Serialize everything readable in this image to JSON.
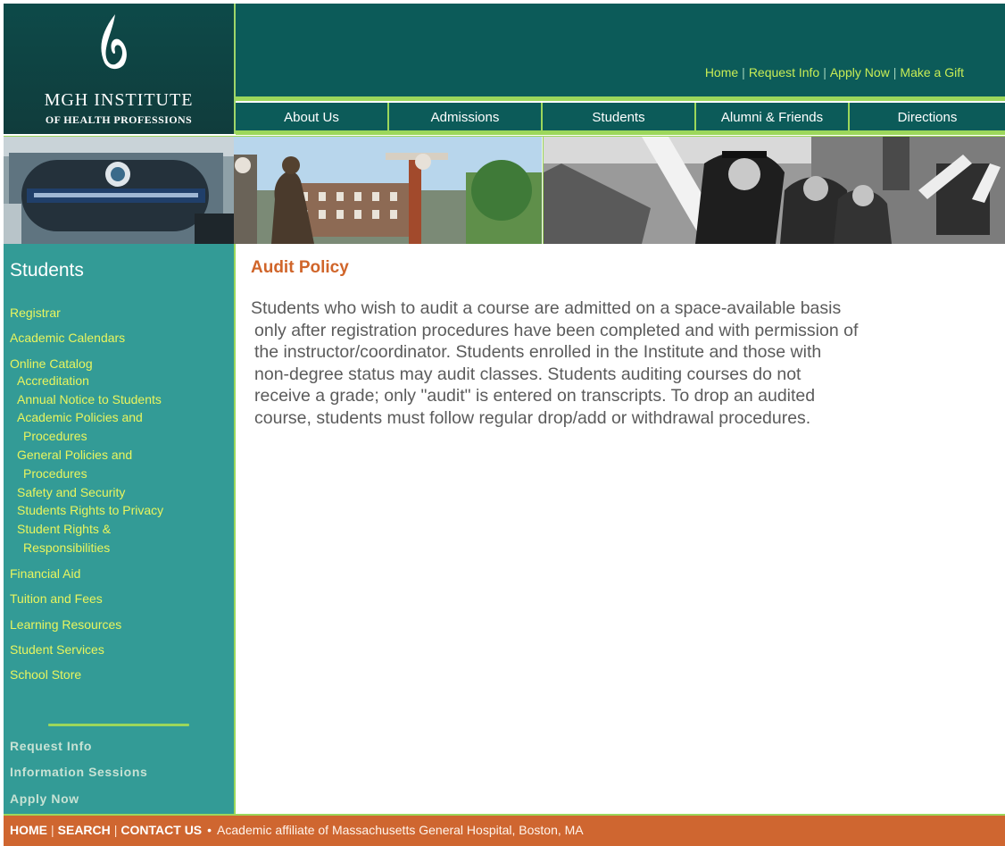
{
  "header": {
    "logo": {
      "title": "MGH INSTITUTE",
      "subtitle": "OF HEALTH PROFESSIONS"
    },
    "utility_links": [
      "Home",
      "Request Info",
      "Apply Now",
      "Make a Gift"
    ],
    "utility_separator": "|",
    "nav": [
      "About Us",
      "Admissions",
      "Students",
      "Alumni & Friends",
      "Directions"
    ]
  },
  "photos": [
    {
      "icon": "building-entrance-photo"
    },
    {
      "icon": "statue-campus-photo"
    },
    {
      "icon": "graduation-procession-photo"
    }
  ],
  "sidebar": {
    "title": "Students",
    "items": [
      {
        "label": "Registrar"
      },
      {
        "label": "Academic Calendars"
      },
      {
        "label": "Online Catalog"
      }
    ],
    "catalog_subitems": [
      [
        "Accreditation"
      ],
      [
        "Annual Notice to Students"
      ],
      [
        "Academic Policies and",
        "Procedures"
      ],
      [
        "General Policies and",
        "Procedures"
      ],
      [
        "Safety and Security"
      ],
      [
        "Students Rights to Privacy"
      ],
      [
        "Student Rights &",
        "Responsibilities"
      ]
    ],
    "more_items": [
      {
        "label": "Financial Aid"
      },
      {
        "label": "Tuition and Fees"
      },
      {
        "label": "Learning Resources"
      },
      {
        "label": "Student Services"
      },
      {
        "label": "School Store"
      }
    ],
    "actions": [
      "Request Info",
      "Information Sessions",
      "Apply Now"
    ]
  },
  "content": {
    "title": "Audit Policy",
    "paragraph_lines": [
      "Students who wish to audit a course are admitted on a space-available basis",
      "only after registration procedures have been completed and with permission of",
      "the instructor/coordinator.  Students enrolled in the Institute and those with",
      "non-degree status may audit classes. Students auditing courses do not",
      "receive a grade; only \"audit\" is entered on transcripts. To drop an audited",
      "course, students must follow regular drop/add or withdrawal procedures."
    ]
  },
  "footer": {
    "links": [
      "HOME",
      "SEARCH",
      "CONTACT US"
    ],
    "separator": "|",
    "bullet": "•",
    "affiliation": "Academic affiliate of Massachusetts General Hospital, Boston, MA"
  },
  "colors": {
    "header_teal": "#0c5b59",
    "accent_green": "#9cd75b",
    "sidebar_teal": "#339b96",
    "link_yellow": "#e9f55e",
    "title_orange": "#d0652a",
    "footer_orange": "#cf6630"
  }
}
